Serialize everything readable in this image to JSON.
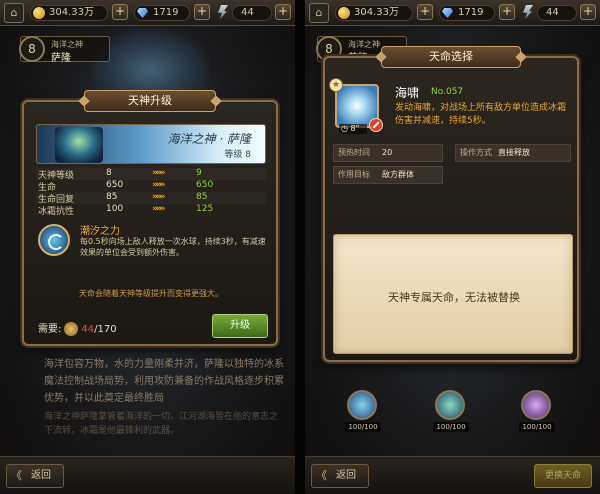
{
  "topbar": {
    "gold": "304.33万",
    "gems": "1719",
    "energy": "44"
  },
  "left": {
    "header": {
      "level": "8",
      "subtitle": "海洋之神",
      "name": "萨隆"
    },
    "panel_title": "天神升级",
    "hero": {
      "name": "海洋之神 · 萨隆",
      "level_text": "等级 8"
    },
    "stats": [
      {
        "label": "天神等级",
        "old": "8",
        "arrow": "»»»",
        "new": "9"
      },
      {
        "label": "生命",
        "old": "650",
        "arrow": "»»»",
        "new": "650"
      },
      {
        "label": "生命回复",
        "old": "85",
        "arrow": "»»»",
        "new": "85"
      },
      {
        "label": "冰霜抗性",
        "old": "100",
        "arrow": "»»»",
        "new": "125"
      }
    ],
    "skill": {
      "name": "潮汐之力",
      "desc": "每0.5秒向场上敌人释放一次水球，持续3秒，有减速效果的单位会受到额外伤害。"
    },
    "note": "天命会随着天神等级提升而变得更强大。",
    "need_label": "需要:",
    "need_current": "44",
    "need_total": "/170",
    "upgrade_button": "升级",
    "lore": "海洋包容万物，水的力量刚柔并济，萨隆以独特的冰系魔法控制战场局势，利用攻防兼备的作战风格逐步积累优势，并以此奠定最终胜局",
    "lore2": "海洋之神萨隆掌管着海洋的一切，江河湖海皆在他的意志之下流转，冰霜是他最锋利的武器。",
    "back_button": "返回"
  },
  "right": {
    "header": {
      "level": "8",
      "subtitle": "海洋之神",
      "name": "萨隆"
    },
    "panel_title": "天命选择",
    "skill": {
      "title": "海啸",
      "no": "No.057",
      "desc": "发动海啸，对战场上所有敌方单位造成冰霜伤害并减速，持续5秒。",
      "cooldown": "8\""
    },
    "info": {
      "prep_label": "预热时间",
      "prep_value": "20",
      "mode_label": "操作方式",
      "mode_value": "直接释放",
      "target_label": "作用目标",
      "target_value": "敌方群体"
    },
    "parchment_text": "天神专属天命，无法被替换",
    "slots": [
      "100/100",
      "100/100",
      "100/100"
    ],
    "back_button": "返回",
    "destiny_button": "更换天命"
  },
  "colors": {
    "gold_text": "#e8a830",
    "green_value": "#8fd33a",
    "need_red": "#e0504a",
    "frame": "#8a6e48"
  }
}
